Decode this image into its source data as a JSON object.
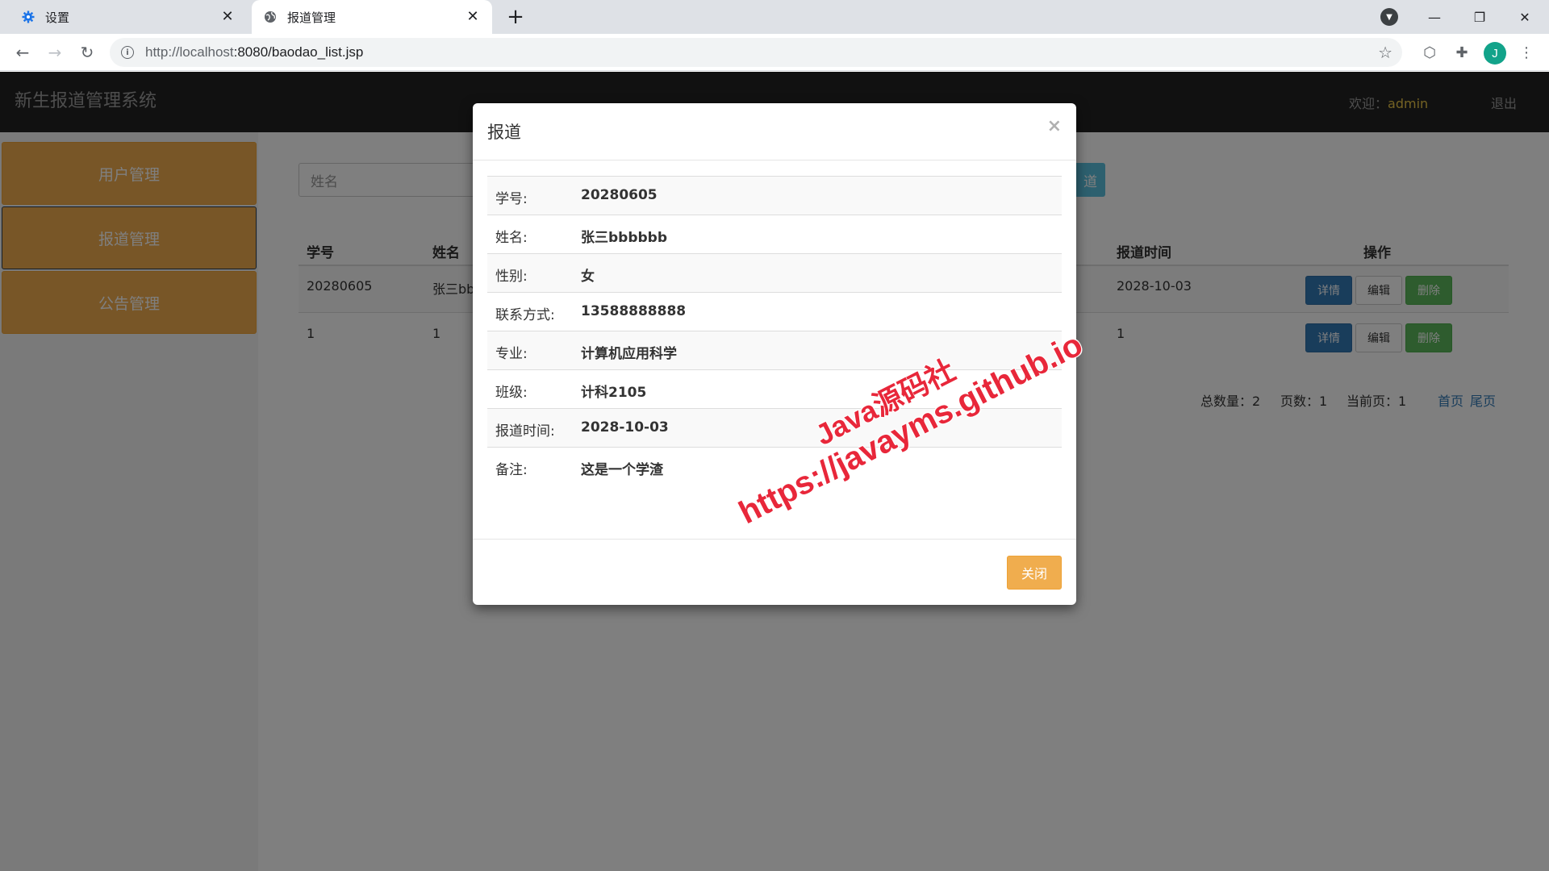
{
  "browser": {
    "tabs": [
      {
        "title": "设置",
        "icon": "gear-icon"
      },
      {
        "title": "报道管理",
        "icon": "globe-icon"
      }
    ],
    "url_host": "http://localhost",
    "url_path": ":8080/baodao_list.jsp",
    "profile_initial": "J"
  },
  "header": {
    "brand": "新生报道管理系统",
    "welcome_label": "欢迎：",
    "username": "admin",
    "logout": "退出"
  },
  "sidebar": {
    "items": [
      {
        "label": "用户管理"
      },
      {
        "label": "报道管理"
      },
      {
        "label": "公告管理"
      }
    ]
  },
  "search": {
    "placeholder": "姓名",
    "add_button_visible_text": "道"
  },
  "table": {
    "headers": {
      "id": "学号",
      "name": "姓名",
      "time": "报道时间",
      "ops": "操作"
    },
    "rows": [
      {
        "id": "20280605",
        "name": "张三bb",
        "time": "2028-10-03"
      },
      {
        "id": "1",
        "name": "1",
        "time": "1"
      }
    ],
    "actions": {
      "detail": "详情",
      "edit": "编辑",
      "delete": "删除"
    }
  },
  "pagination": {
    "total": "总数量：2",
    "pages": "页数：1",
    "current": "当前页：1",
    "first": "首页",
    "last": "尾页"
  },
  "modal": {
    "title": "报道",
    "close_x": "×",
    "fields": [
      {
        "label": "学号:",
        "value": "20280605"
      },
      {
        "label": "姓名:",
        "value": "张三bbbbbb"
      },
      {
        "label": "性别:",
        "value": "女"
      },
      {
        "label": "联系方式:",
        "value": "13588888888"
      },
      {
        "label": "专业:",
        "value": "计算机应用科学"
      },
      {
        "label": "班级:",
        "value": "计科2105"
      },
      {
        "label": "报道时间:",
        "value": "2028-10-03"
      },
      {
        "label": "备注:",
        "value": "这是一个学渣"
      }
    ],
    "close_button": "关闭"
  },
  "watermark": {
    "line1": "Java源码社",
    "line2": "https://javayms.github.io"
  }
}
